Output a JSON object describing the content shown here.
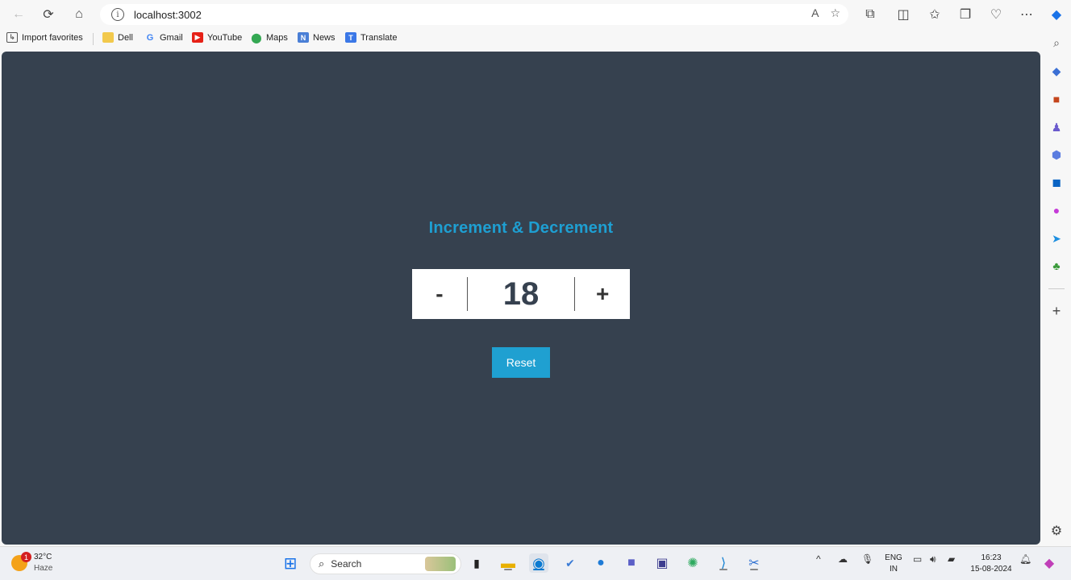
{
  "browser": {
    "url": "localhost:3002"
  },
  "favorites": [
    {
      "label": "Import favorites",
      "icon": "import-icon"
    },
    {
      "label": "Dell",
      "icon": "folder-icon"
    },
    {
      "label": "Gmail",
      "icon": "google-icon"
    },
    {
      "label": "YouTube",
      "icon": "youtube-icon"
    },
    {
      "label": "Maps",
      "icon": "maps-pin-icon"
    },
    {
      "label": "News",
      "icon": "news-icon"
    },
    {
      "label": "Translate",
      "icon": "translate-icon"
    }
  ],
  "app": {
    "title": "Increment & Decrement",
    "decrement_label": "-",
    "increment_label": "+",
    "count": "18",
    "reset_label": "Reset"
  },
  "taskbar": {
    "weather_temp": "32°C",
    "weather_condition": "Haze",
    "weather_badge": "1",
    "search_label": "Search",
    "lang_primary": "ENG",
    "lang_secondary": "IN",
    "time": "16:23",
    "date": "15-08-2024"
  },
  "colors": {
    "page_bg": "#36414f",
    "accent": "#1e9fd2",
    "button": "#1fa0d1"
  }
}
